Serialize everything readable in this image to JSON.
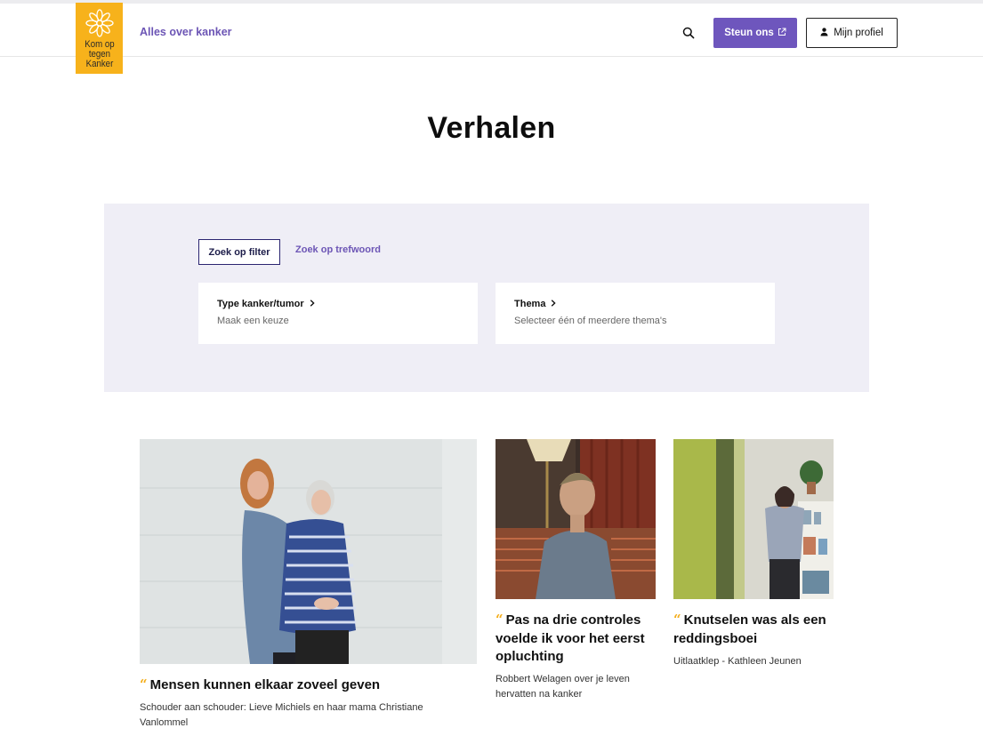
{
  "header": {
    "logo_lines": [
      "Kom op",
      "tegen",
      "Kanker"
    ],
    "nav_link": "Alles over kanker",
    "search_icon": "search-icon",
    "steun_label": "Steun ons",
    "steun_icon": "external-link-icon",
    "profiel_label": "Mijn profiel",
    "profiel_icon": "user-icon"
  },
  "page": {
    "title": "Verhalen"
  },
  "filter": {
    "tab_filter": "Zoek op filter",
    "tab_keyword": "Zoek op trefwoord",
    "cards": [
      {
        "title": "Type kanker/tumor",
        "subtitle": "Maak een keuze"
      },
      {
        "title": "Thema",
        "subtitle": "Selecteer één of meerdere thema's"
      }
    ]
  },
  "stories": [
    {
      "quote_mark": "“",
      "title": "Mensen kunnen elkaar zoveel geven",
      "subtitle": "Schouder aan schouder: Lieve Michiels en haar mama Christiane Vanlommel"
    },
    {
      "quote_mark": "“",
      "title": "Pas na drie controles voelde ik voor het eerst opluchting",
      "subtitle": "Robbert Welagen over je leven hervatten na kanker"
    },
    {
      "quote_mark": "“",
      "title": "Knutselen was als een reddingsboei",
      "subtitle": "Uitlaatklep - Kathleen Jeunen"
    }
  ],
  "colors": {
    "brand_yellow": "#f7b21b",
    "accent_purple": "#6e56bd",
    "panel_bg": "#efeef6"
  }
}
